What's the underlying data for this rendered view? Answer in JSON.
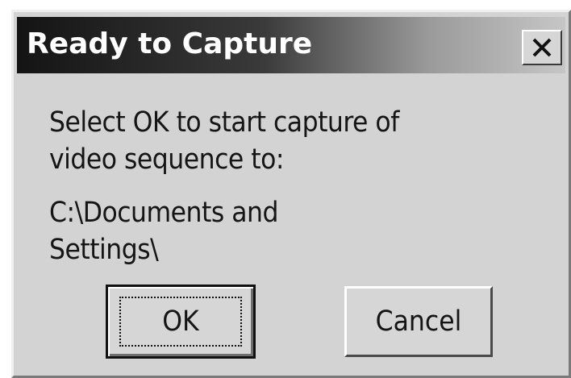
{
  "dialog": {
    "title": "Ready to Capture",
    "close_icon": "close-x-icon",
    "message_line1": "Select OK to start capture of",
    "message_line2": "video sequence to:",
    "path_line1": "C:\\Documents and",
    "path_line2": "Settings\\",
    "ok_label": "OK",
    "cancel_label": "Cancel"
  },
  "colors": {
    "dialog_background": "#d3d3d3",
    "titlebar_dark": "#141414",
    "titlebar_light": "#c6c6c6",
    "title_text": "#ffffff"
  }
}
